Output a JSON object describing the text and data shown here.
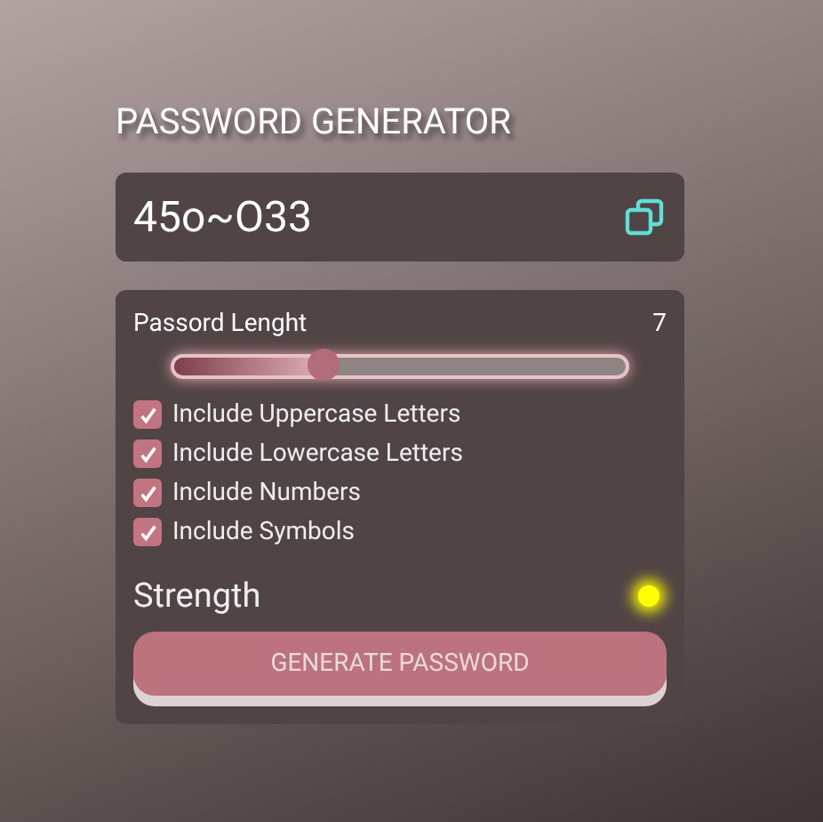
{
  "title": "PASSWORD GENERATOR",
  "password": {
    "value": "45o~O33"
  },
  "length": {
    "label": "Passord Lenght",
    "value": "7",
    "level": 0.33
  },
  "options": [
    {
      "label": "Include Uppercase Letters",
      "checked": true
    },
    {
      "label": "Include Lowercase Letters",
      "checked": true
    },
    {
      "label": "Include Numbers",
      "checked": true
    },
    {
      "label": "Include Symbols",
      "checked": true
    }
  ],
  "strength": {
    "label": "Strength",
    "color": "#ffff00"
  },
  "button": "GENERATE PASSWORD"
}
